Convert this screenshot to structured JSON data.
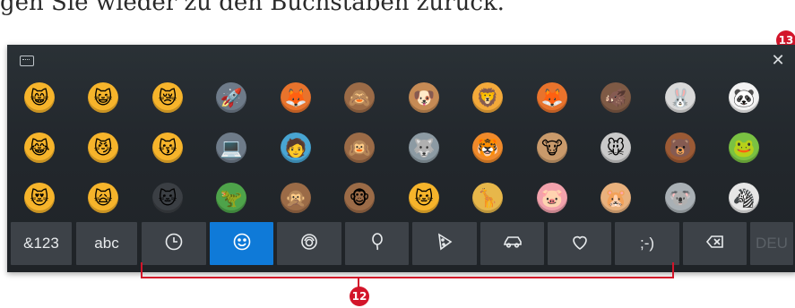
{
  "document": {
    "text_line": "gen Sie wieder zu den Buchstaben zurück."
  },
  "callouts": {
    "close": "13",
    "tabs": "12"
  },
  "keyboard": {
    "close_symbol": "✕",
    "keyboard_icon": "keyboard-settings-icon",
    "emoji_rows": [
      [
        {
          "name": "grinning-cat",
          "glyph": "😸",
          "color": "#f6b42b"
        },
        {
          "name": "smiling-cat",
          "glyph": "😺",
          "color": "#f6b42b"
        },
        {
          "name": "crying-cat",
          "glyph": "😿",
          "color": "#f6b42b"
        },
        {
          "name": "ninja-cat-rocket",
          "glyph": "🚀",
          "color": "#6e7b89"
        },
        {
          "name": "ninja-cat-fox",
          "glyph": "🦊",
          "color": "#e8732c"
        },
        {
          "name": "see-no-evil-monkey",
          "glyph": "🙈",
          "color": "#9b6b47"
        },
        {
          "name": "dog",
          "glyph": "🐶",
          "color": "#c68b55"
        },
        {
          "name": "lion",
          "glyph": "🦁",
          "color": "#f3a93a"
        },
        {
          "name": "fox",
          "glyph": "🦊",
          "color": "#e8732c"
        },
        {
          "name": "boar",
          "glyph": "🐗",
          "color": "#7e5a45"
        },
        {
          "name": "rabbit",
          "glyph": "🐰",
          "color": "#d9d9d9"
        },
        {
          "name": "panda",
          "glyph": "🐼",
          "color": "#f2f2f2"
        }
      ],
      [
        {
          "name": "joy-cat",
          "glyph": "😹",
          "color": "#f6b42b"
        },
        {
          "name": "smirk-cat",
          "glyph": "😼",
          "color": "#f6b42b"
        },
        {
          "name": "kissing-cat",
          "glyph": "😽",
          "color": "#f6b42b"
        },
        {
          "name": "ninja-cat-computer",
          "glyph": "💻",
          "color": "#6e7b89"
        },
        {
          "name": "astronaut-cat",
          "glyph": "🧑",
          "color": "#48a5d3"
        },
        {
          "name": "hear-no-evil-monkey",
          "glyph": "🙉",
          "color": "#9b6b47"
        },
        {
          "name": "wolf",
          "glyph": "🐺",
          "color": "#8c9aa3"
        },
        {
          "name": "tiger",
          "glyph": "🐯",
          "color": "#f08a2b"
        },
        {
          "name": "cow",
          "glyph": "🐮",
          "color": "#c99a6b"
        },
        {
          "name": "mouse",
          "glyph": "🐭",
          "color": "#c9c9c9"
        },
        {
          "name": "bear",
          "glyph": "🐻",
          "color": "#9b5a35"
        },
        {
          "name": "frog",
          "glyph": "🐸",
          "color": "#7ac142"
        }
      ],
      [
        {
          "name": "heart-eyes-cat",
          "glyph": "😻",
          "color": "#f6b42b"
        },
        {
          "name": "scream-cat",
          "glyph": "🙀",
          "color": "#f6b42b"
        },
        {
          "name": "ninja-cat",
          "glyph": "🐱",
          "color": "#3b3f44"
        },
        {
          "name": "dino-cat",
          "glyph": "🦖",
          "color": "#4ea34a"
        },
        {
          "name": "speak-no-evil-monkey",
          "glyph": "🙊",
          "color": "#9b6b47"
        },
        {
          "name": "monkey-face",
          "glyph": "🐵",
          "color": "#9b6b47"
        },
        {
          "name": "cat-face",
          "glyph": "🐱",
          "color": "#f6b42b"
        },
        {
          "name": "giraffe",
          "glyph": "🦒",
          "color": "#e7b74a"
        },
        {
          "name": "pig",
          "glyph": "🐷",
          "color": "#f2a2ac"
        },
        {
          "name": "hamster",
          "glyph": "🐹",
          "color": "#e9b17d"
        },
        {
          "name": "koala",
          "glyph": "🐨",
          "color": "#a9b0b5"
        },
        {
          "name": "zebra",
          "glyph": "🦓",
          "color": "#e6e6e6"
        }
      ]
    ],
    "tabs": [
      {
        "name": "tab-numbers",
        "label": "&123",
        "kind": "text"
      },
      {
        "name": "tab-abc",
        "label": "abc",
        "kind": "text"
      },
      {
        "name": "tab-recent",
        "icon": "clock-icon",
        "kind": "icon"
      },
      {
        "name": "tab-smileys",
        "icon": "smiley-icon",
        "kind": "icon"
      },
      {
        "name": "tab-people",
        "icon": "person-icon",
        "kind": "icon"
      },
      {
        "name": "tab-celebration",
        "icon": "balloon-icon",
        "kind": "icon"
      },
      {
        "name": "tab-food",
        "icon": "pizza-icon",
        "kind": "icon"
      },
      {
        "name": "tab-travel",
        "icon": "car-icon",
        "kind": "icon"
      },
      {
        "name": "tab-symbols",
        "icon": "heart-icon",
        "kind": "icon"
      },
      {
        "name": "tab-emoticons",
        "label": ";-)",
        "kind": "text"
      },
      {
        "name": "tab-backspace",
        "icon": "backspace-icon",
        "kind": "icon"
      },
      {
        "name": "tab-language",
        "label": "DEU",
        "kind": "text"
      }
    ],
    "active_tab": "tab-smileys",
    "accent_color": "#0f7ad8"
  }
}
